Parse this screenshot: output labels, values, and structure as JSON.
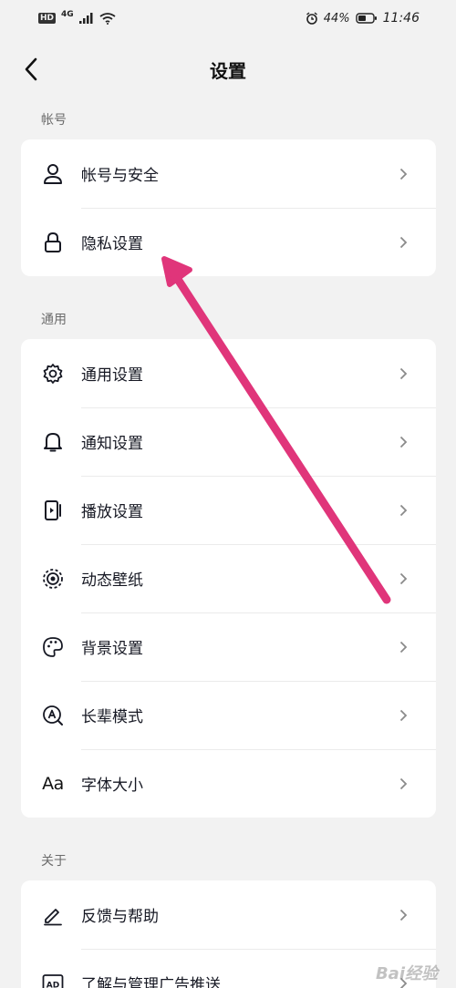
{
  "status_bar": {
    "hd": "HD",
    "network": "4G",
    "battery": "44%",
    "time": "11:46"
  },
  "header": {
    "title": "设置"
  },
  "sections": [
    {
      "label": "帐号",
      "items": [
        {
          "label": "帐号与安全",
          "icon": "person-icon"
        },
        {
          "label": "隐私设置",
          "icon": "lock-icon"
        }
      ]
    },
    {
      "label": "通用",
      "items": [
        {
          "label": "通用设置",
          "icon": "gear-icon"
        },
        {
          "label": "通知设置",
          "icon": "bell-icon"
        },
        {
          "label": "播放设置",
          "icon": "play-device-icon"
        },
        {
          "label": "动态壁纸",
          "icon": "dynamic-wallpaper-icon"
        },
        {
          "label": "背景设置",
          "icon": "palette-icon"
        },
        {
          "label": "长辈模式",
          "icon": "elder-mode-icon"
        },
        {
          "label": "字体大小",
          "icon": "font-size-icon",
          "glyph": "Aa"
        }
      ]
    },
    {
      "label": "关于",
      "items": [
        {
          "label": "反馈与帮助",
          "icon": "pen-icon"
        },
        {
          "label": "了解与管理广告推送",
          "icon": "ad-icon"
        }
      ]
    }
  ],
  "watermark": "Bai经验",
  "annotation": {
    "color": "#e0357a"
  }
}
